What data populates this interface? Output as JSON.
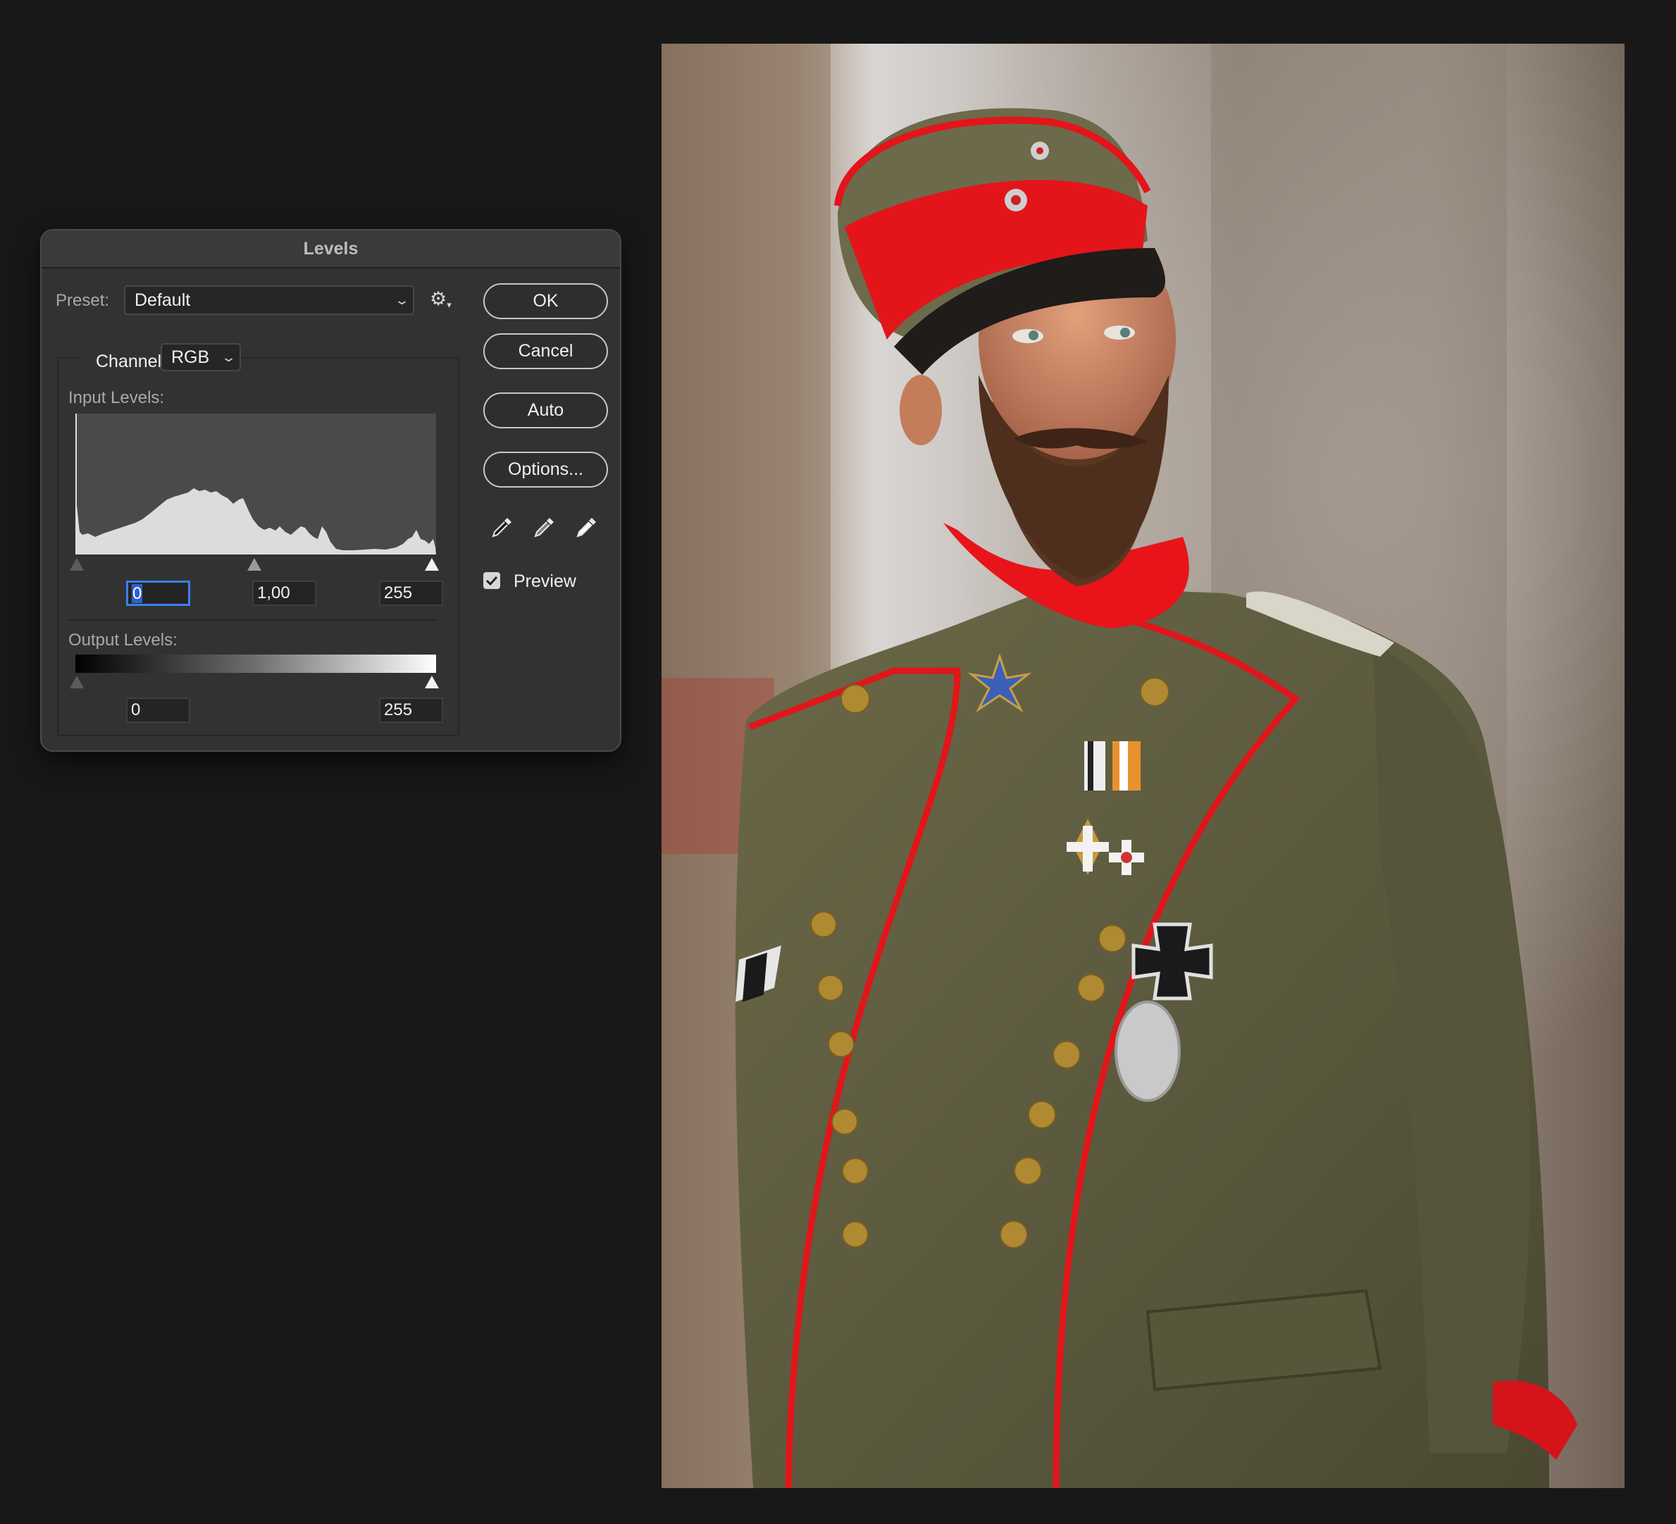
{
  "dialog": {
    "title": "Levels",
    "preset": {
      "label": "Preset:",
      "value": "Default"
    },
    "channel": {
      "label": "Channel:",
      "value": "RGB"
    },
    "input_levels": {
      "label": "Input Levels:",
      "black": "0",
      "gamma": "1,00",
      "white": "255"
    },
    "output_levels": {
      "label": "Output Levels:",
      "black": "0",
      "white": "255"
    },
    "buttons": {
      "ok": "OK",
      "cancel": "Cancel",
      "auto": "Auto",
      "options": "Options..."
    },
    "preview": {
      "label": "Preview",
      "checked": true
    },
    "icons": [
      "gear-icon",
      "black-point-eyedropper-icon",
      "gray-point-eyedropper-icon",
      "white-point-eyedropper-icon",
      "checkmark-icon",
      "chevron-down-icon"
    ]
  },
  "canvas": {
    "subject": "photo",
    "colors": {
      "uniform": "#5f5c40",
      "piping": "#e0161a",
      "collar": "#e8141a",
      "buttons": "#b08a32",
      "background_light": "#d9d6d3"
    }
  }
}
